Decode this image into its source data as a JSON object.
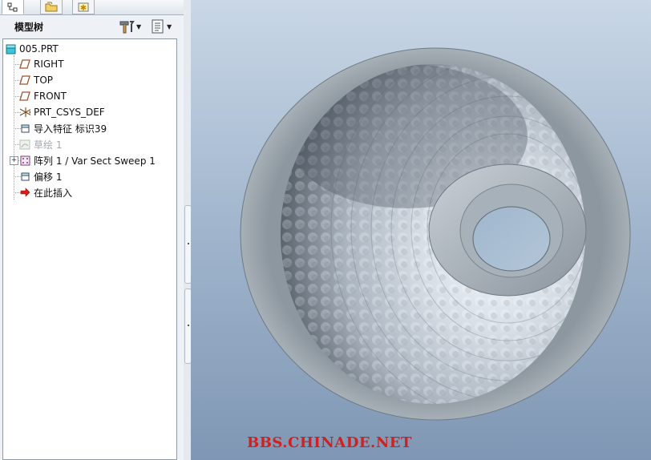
{
  "tree_panel": {
    "title": "模型树",
    "items": [
      {
        "label": "005.PRT",
        "icon": "part-icon",
        "dim": false
      },
      {
        "label": "RIGHT",
        "icon": "datum-plane-icon",
        "dim": false
      },
      {
        "label": "TOP",
        "icon": "datum-plane-icon",
        "dim": false
      },
      {
        "label": "FRONT",
        "icon": "datum-plane-icon",
        "dim": false
      },
      {
        "label": "PRT_CSYS_DEF",
        "icon": "csys-icon",
        "dim": false
      },
      {
        "label": "导入特征 标识39",
        "icon": "import-feature-icon",
        "dim": false
      },
      {
        "label": "草绘 1",
        "icon": "sketch-icon",
        "dim": true
      },
      {
        "label": "阵列 1 / Var Sect Sweep 1",
        "icon": "pattern-icon",
        "dim": false
      },
      {
        "label": "偏移 1",
        "icon": "offset-icon",
        "dim": false
      },
      {
        "label": "在此插入",
        "icon": "insert-here-arrow-icon",
        "dim": false
      }
    ]
  },
  "graphics": {
    "watermark": "BBS.CHINADE.NET"
  },
  "colors": {
    "accent_red": "#d02020",
    "datum_plane": "#a0522d",
    "part_cyan": "#38c6d9"
  }
}
